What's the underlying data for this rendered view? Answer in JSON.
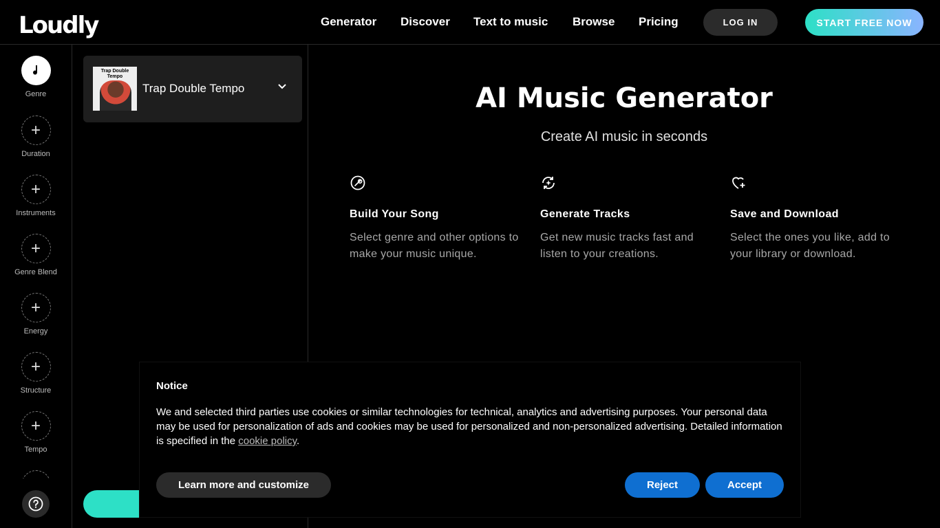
{
  "header": {
    "logo": "Loudly",
    "nav": [
      "Generator",
      "Discover",
      "Text to music",
      "Browse",
      "Pricing"
    ],
    "login_label": "LOG IN",
    "start_label": "START FREE NOW"
  },
  "rail": {
    "items": [
      {
        "label": "Genre",
        "icon": "music-note-icon"
      },
      {
        "label": "Duration",
        "icon": "plus-icon"
      },
      {
        "label": "Instruments",
        "icon": "plus-icon"
      },
      {
        "label": "Genre Blend",
        "icon": "plus-icon"
      },
      {
        "label": "Energy",
        "icon": "plus-icon"
      },
      {
        "label": "Structure",
        "icon": "plus-icon"
      },
      {
        "label": "Tempo",
        "icon": "plus-icon"
      }
    ],
    "help_icon": "help-icon"
  },
  "panel": {
    "genre_name": "Trap Double Tempo",
    "thumb_title": "Trap Double Tempo"
  },
  "main": {
    "title": "AI Music Generator",
    "subtitle": "Create AI music in seconds",
    "features": [
      {
        "icon": "wrench-icon",
        "title": "Build Your Song",
        "desc": "Select genre and other options to make your music unique."
      },
      {
        "icon": "refresh-sparkle-icon",
        "title": "Generate Tracks",
        "desc": "Get new music tracks fast and listen to your creations."
      },
      {
        "icon": "heart-plus-icon",
        "title": "Save and Download",
        "desc": "Select the ones you like, add to your library or download."
      }
    ]
  },
  "notice": {
    "title": "Notice",
    "body_prefix": "We and selected third parties use cookies or similar technologies for technical, analytics and advertising purposes. Your personal data may be used for personalization of ads and cookies may be used for personalized and non-personalized advertising. Detailed information is specified in the ",
    "link": "cookie policy",
    "body_suffix": ".",
    "customize_label": "Learn more and customize",
    "reject_label": "Reject",
    "accept_label": "Accept"
  },
  "colors": {
    "accent_teal": "#2de0c6",
    "button_blue": "#0f6fd1"
  }
}
